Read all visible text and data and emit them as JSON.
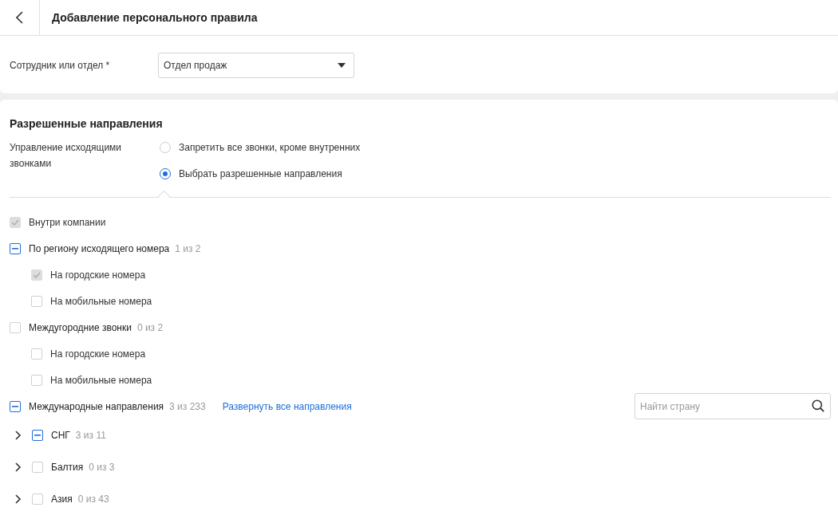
{
  "header": {
    "title": "Добавление персонального правила"
  },
  "employee_field": {
    "label": "Сотрудник или отдел *",
    "value": "Отдел продаж"
  },
  "section": {
    "title": "Разрешенные направления"
  },
  "outgoing": {
    "label": "Управление исходящими звонками",
    "options": [
      {
        "label": "Запретить все звонки, кроме внутренних",
        "selected": false
      },
      {
        "label": "Выбрать разрешенные направления",
        "selected": true
      }
    ]
  },
  "directions": [
    {
      "kind": "option",
      "label": "Внутри компании",
      "checked": true,
      "partial": false,
      "disabled": true
    },
    {
      "kind": "group",
      "label": "По региону исходящего номера",
      "count": "1 из 2",
      "checked": false,
      "partial": true,
      "disabled": false,
      "children": [
        {
          "kind": "option",
          "label": "На городские номера",
          "checked": true,
          "partial": false,
          "disabled": true
        },
        {
          "kind": "option",
          "label": "На мобильные номера",
          "checked": false,
          "partial": false,
          "disabled": false
        }
      ]
    },
    {
      "kind": "group",
      "label": "Междугородние звонки",
      "count": "0 из 2",
      "checked": false,
      "partial": false,
      "disabled": false,
      "children": [
        {
          "kind": "option",
          "label": "На городские номера",
          "checked": false,
          "partial": false,
          "disabled": false
        },
        {
          "kind": "option",
          "label": "На мобильные номера",
          "checked": false,
          "partial": false,
          "disabled": false
        }
      ]
    },
    {
      "kind": "international",
      "label": "Международные направления",
      "count": "3 из 233",
      "checked": false,
      "partial": true,
      "disabled": false,
      "link": "Развернуть все направления",
      "search": {
        "placeholder": "Найти страну"
      },
      "children": [
        {
          "kind": "region",
          "label": "СНГ",
          "count": "3 из 11",
          "checked": false,
          "partial": true,
          "disabled": false,
          "expanded": false
        },
        {
          "kind": "region",
          "label": "Балтия",
          "count": "0 из 3",
          "checked": false,
          "partial": false,
          "disabled": false,
          "expanded": false
        },
        {
          "kind": "region",
          "label": "Азия",
          "count": "0 из 43",
          "checked": false,
          "partial": false,
          "disabled": false,
          "expanded": false
        }
      ]
    }
  ]
}
